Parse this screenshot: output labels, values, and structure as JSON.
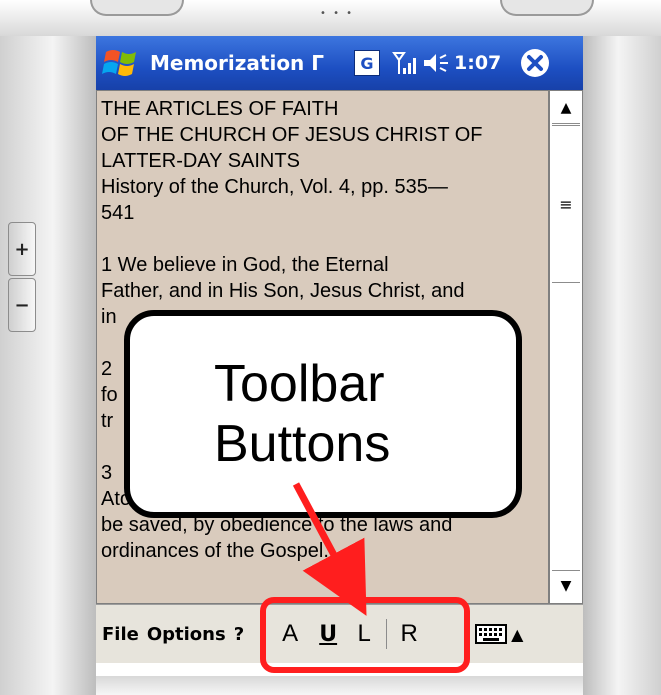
{
  "title_bar": {
    "title": "Memorization Г",
    "g_label": "G",
    "clock": "1:07",
    "icons": [
      "windows-start-icon",
      "signal-icon",
      "speaker-icon",
      "close-icon"
    ]
  },
  "content": {
    "lines": [
      "THE ARTICLES OF FAITH",
      "OF THE CHURCH OF JESUS CHRIST OF",
      "LATTER-DAY SAINTS",
      "History of the Church, Vol. 4, pp. 535—",
      "541",
      "",
      "1 We believe in God, the Eternal",
      "Father, and in His Son, Jesus Christ, and",
      "in",
      "",
      "2",
      "fo",
      "tr",
      "",
      "3",
      "Atonement of Christ, all mankind may",
      "be saved, by obedience to the laws and",
      "ordinances of the Gospel."
    ]
  },
  "toolbar": {
    "menus": [
      "File",
      "Options",
      "?"
    ],
    "buttons": [
      "A",
      "U",
      "L",
      "R"
    ]
  },
  "device": {
    "volume_up": "+",
    "volume_down": "−"
  },
  "callout": {
    "line1": "Toolbar",
    "line2": "Buttons"
  },
  "colors": {
    "titlebar": "#1d4fc2",
    "content_bg": "#d9cbbd",
    "highlight": "#ff1e1e"
  }
}
